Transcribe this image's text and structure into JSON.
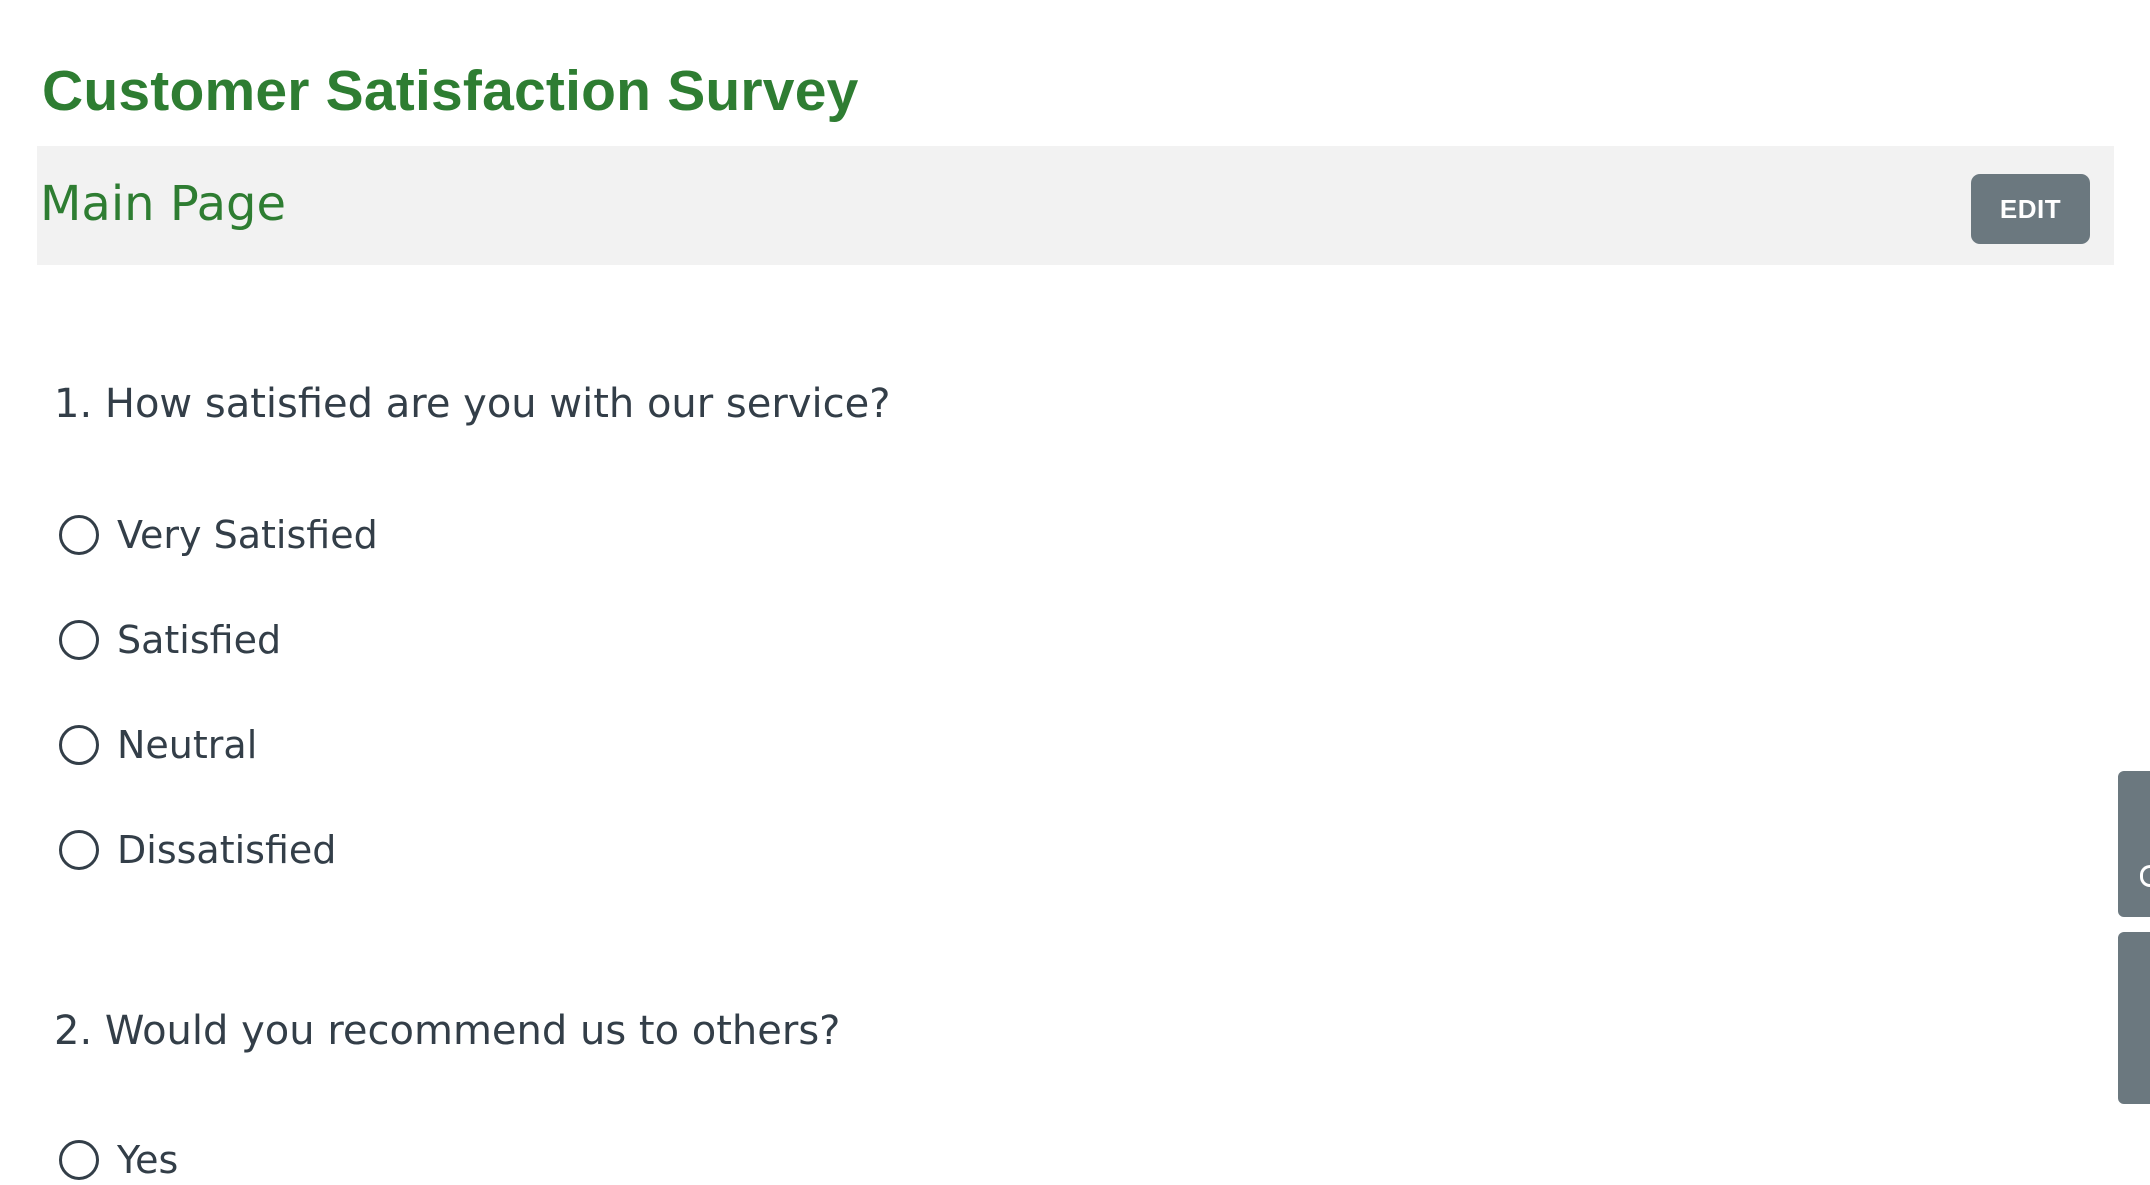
{
  "survey": {
    "title": "Customer Satisfaction Survey"
  },
  "page_bar": {
    "title": "Main Page",
    "edit_label": "EDIT"
  },
  "questions": [
    {
      "text": "1. How satisfied are you with our service?",
      "options": [
        "Very Satisfied",
        "Satisfied",
        "Neutral",
        "Dissatisfied"
      ],
      "selected": null
    },
    {
      "text": "2. Would you recommend us to others?",
      "options": [
        "Yes"
      ],
      "selected": null
    }
  ],
  "colors": {
    "title_green": "#2e7d32",
    "page_bar_background": "#f2f2f2",
    "button_gray": "#6b787f",
    "text_dark": "#333e48"
  },
  "side_tabs": [
    {
      "name": "side-feedback-tab"
    },
    {
      "name": "side-help-tab"
    }
  ]
}
